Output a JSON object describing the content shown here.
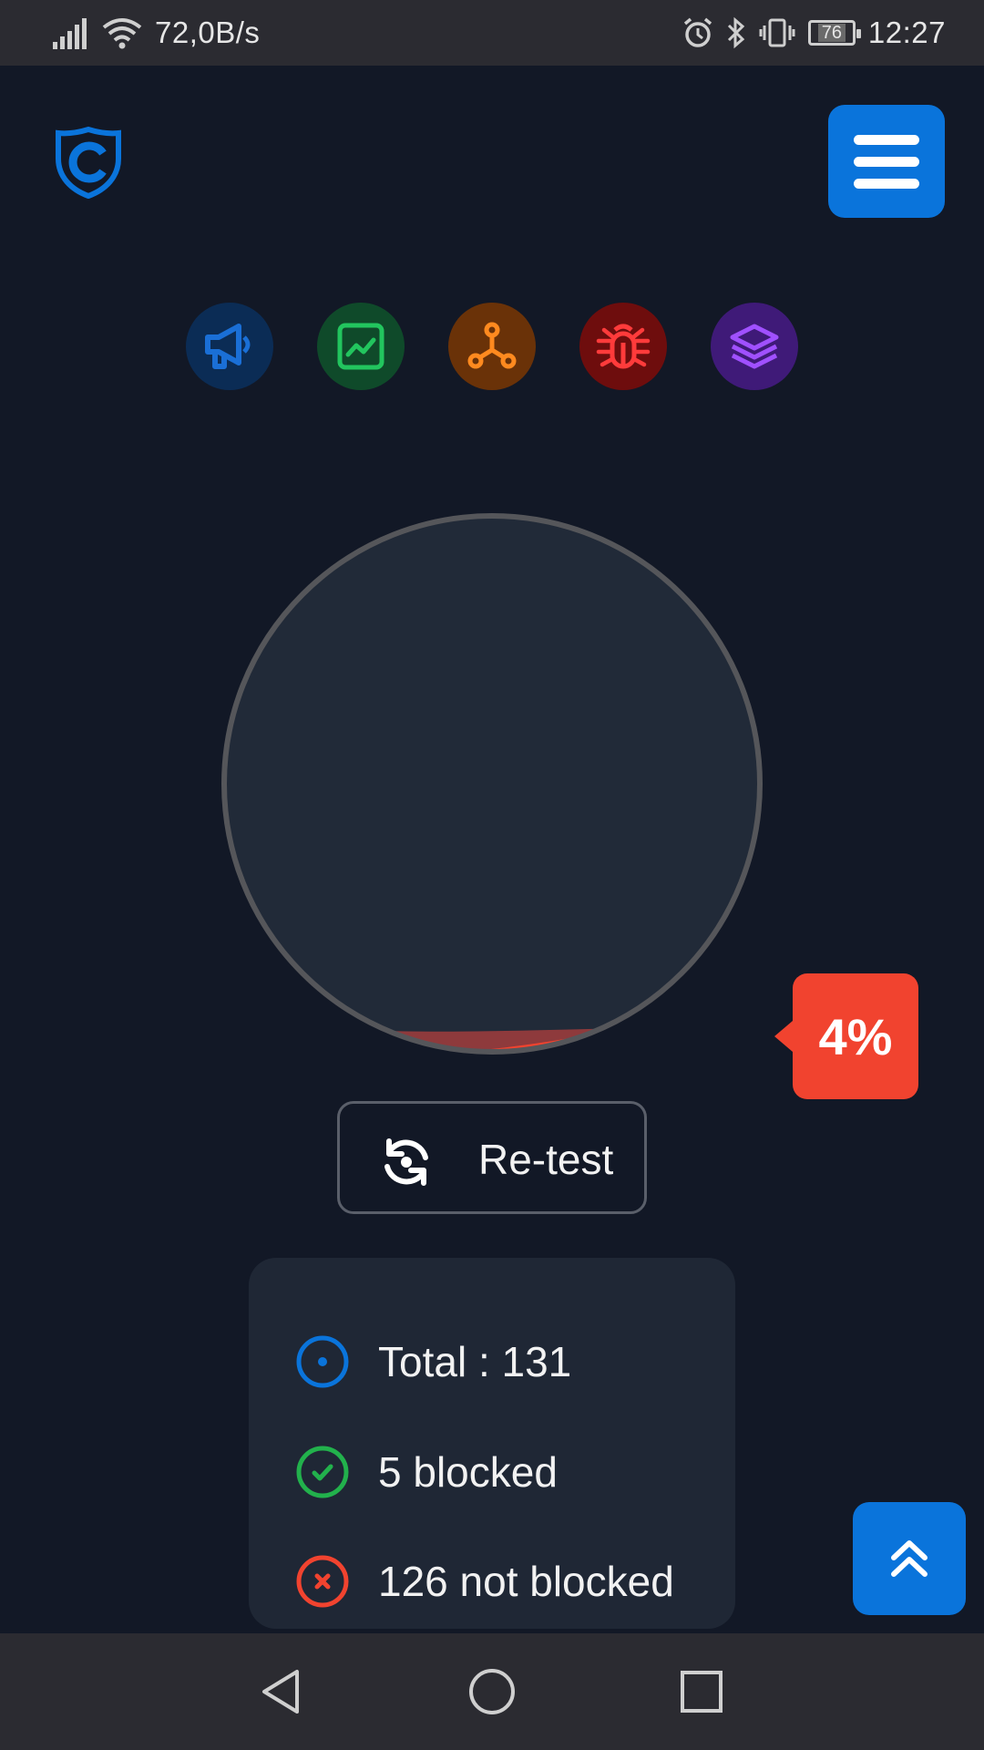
{
  "status_bar": {
    "speed": "72,0B/s",
    "battery": "76",
    "time": "12:27"
  },
  "colors": {
    "background": "#121826",
    "accent_blue": "#0a74db",
    "danger_red": "#f1432f",
    "success_green": "#22b14c",
    "panel": "#1f2735"
  },
  "header": {
    "logo_icon": "shield-logo-icon",
    "menu_icon": "hamburger-menu-icon"
  },
  "categories": [
    {
      "icon": "megaphone-icon",
      "color": "#1a6fd6",
      "bg": "#0b2c55"
    },
    {
      "icon": "chart-icon",
      "color": "#22c55e",
      "bg": "#0f4a2a"
    },
    {
      "icon": "network-nodes-icon",
      "color": "#ff8a1f",
      "bg": "#6a3208"
    },
    {
      "icon": "bug-icon",
      "color": "#ff3b3b",
      "bg": "#6e0d0d"
    },
    {
      "icon": "layers-icon",
      "color": "#a050ff",
      "bg": "#3f1a78"
    }
  ],
  "gauge": {
    "percent_blocked": 4,
    "percent_label": "4%"
  },
  "retest": {
    "label": "Re-test",
    "icon": "refresh-icon"
  },
  "stats": {
    "total": "Total : 131",
    "blocked": "5 blocked",
    "not_blocked": "126 not blocked"
  },
  "nav": {
    "back_icon": "back-triangle-icon",
    "home_icon": "home-circle-icon",
    "recents_icon": "recents-square-icon"
  }
}
